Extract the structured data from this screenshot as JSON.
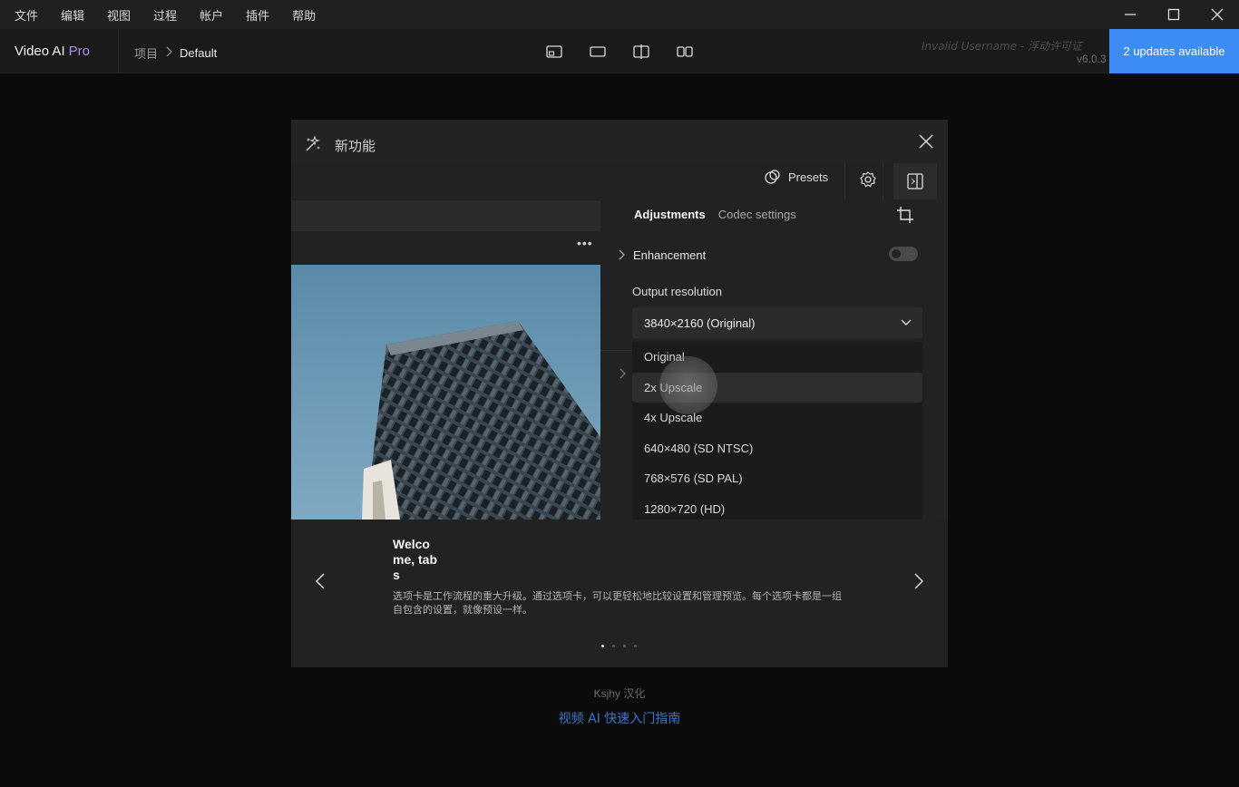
{
  "menubar": {
    "items": [
      "文件",
      "编辑",
      "视图",
      "过程",
      "帐户",
      "插件",
      "帮助"
    ],
    "window_controls": [
      "minimize-icon",
      "maximize-icon",
      "close-icon"
    ]
  },
  "header": {
    "app_name": "Video AI",
    "app_edition": "Pro",
    "breadcrumb": {
      "root": "项目",
      "current": "Default"
    },
    "view_modes": [
      "single-view-icon",
      "full-view-icon",
      "split-view-icon",
      "side-by-side-view-icon"
    ],
    "license_text": "Invalid Username - 浮动许可证",
    "version": "v6.0.3",
    "updates_button": "2 updates available",
    "accent_color": "#3d8bf5",
    "pro_color": "#a98bff"
  },
  "modal": {
    "title": "新功能",
    "preview": {
      "presets_label": "Presets",
      "tabs": [
        "Adjustments",
        "Codec settings"
      ],
      "enhancement_label": "Enhancement",
      "enhancement_enabled": false,
      "output_resolution_label": "Output resolution",
      "selected_resolution": "3840×2160 (Original)",
      "resolution_options": [
        "Original",
        "2x Upscale",
        "4x Upscale",
        "640×480 (SD NTSC)",
        "768×576 (SD PAL)",
        "1280×720 (HD)"
      ],
      "hovered_option": "2x Upscale"
    },
    "slide": {
      "title": "Welcome, tabs",
      "description": "选项卡是工作流程的重大升级。通过选项卡，可以更轻松地比较设置和管理预览。每个选项卡都是一组自包含的设置，就像预设一样。",
      "page_count": 4,
      "current_page": 1
    }
  },
  "footer": {
    "credit_name": "Ksjhy",
    "credit_suffix": "汉化",
    "guide_link": "视频 AI 快速入门指南"
  }
}
